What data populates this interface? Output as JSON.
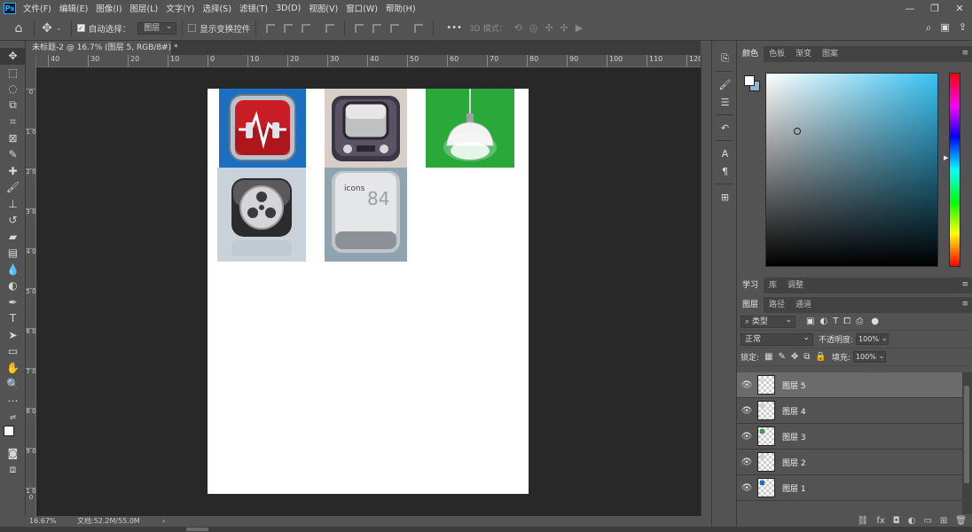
{
  "menu": {
    "logo": "Ps",
    "items": [
      "文件(F)",
      "编辑(E)",
      "图像(I)",
      "图层(L)",
      "文字(Y)",
      "选择(S)",
      "滤镜(T)",
      "3D(D)",
      "视图(V)",
      "窗口(W)",
      "帮助(H)"
    ]
  },
  "window_controls": {
    "minimize": "—",
    "restore": "❐",
    "close": "✕"
  },
  "options": {
    "auto_select_label": "自动选择：",
    "auto_select_value": "图层",
    "show_transform_label": "显示变换控件",
    "mode_3d_label": "3D 模式：",
    "more": "•••"
  },
  "document": {
    "tab_title": "未标题-2 @ 16.7% (图层 5, RGB/8#) *",
    "close": "×",
    "thumbs": [
      {
        "name": "heart-pulse",
        "bg": "#1a6fc3"
      },
      {
        "name": "tv",
        "bg": "#d6cec7"
      },
      {
        "name": "lamp",
        "bg": "#2aa83a"
      },
      {
        "name": "film-reel",
        "bg": "#c9d2da"
      },
      {
        "name": "icons-84",
        "bg": "#8fa4b0",
        "label": "icons",
        "number": "84"
      }
    ]
  },
  "hruler_labels": [
    "40",
    "30",
    "20",
    "10",
    "0",
    "10",
    "20",
    "30",
    "40",
    "50",
    "60",
    "70",
    "80",
    "90",
    "100",
    "110",
    "120"
  ],
  "vruler_labels": [
    "0",
    "1 0",
    "2 0",
    "3 0",
    "4 0",
    "5 0",
    "6 0",
    "7 0",
    "8 0",
    "9 0",
    "1 0 0"
  ],
  "status": {
    "zoom": "16.67%",
    "doc": "文档:52.2M/55.0M",
    "arrow": "›"
  },
  "color_panel": {
    "tabs": [
      "颜色",
      "色板",
      "渐变",
      "图案"
    ],
    "fg": "#ffffff",
    "bg": "#8fb3d0",
    "hue": "#39c2f4"
  },
  "learn_tabs": [
    "学习",
    "库",
    "调整"
  ],
  "layers_panel": {
    "tabs": [
      "图层",
      "路径",
      "通道"
    ],
    "filter_label": "类型",
    "blend_mode": "正常",
    "opacity_label": "不透明度:",
    "opacity_value": "100%",
    "lock_label": "锁定:",
    "fill_label": "填充:",
    "fill_value": "100%",
    "layers": [
      {
        "name": "图层 5",
        "selected": true,
        "dot": "#dddddd"
      },
      {
        "name": "图层 4",
        "selected": false,
        "dot": "#c9d2da"
      },
      {
        "name": "图层 3",
        "selected": false,
        "dot": "#2aa83a"
      },
      {
        "name": "图层 2",
        "selected": false,
        "dot": "#d6cec7"
      },
      {
        "name": "图层 1",
        "selected": false,
        "dot": "#1a6fc3"
      }
    ]
  }
}
